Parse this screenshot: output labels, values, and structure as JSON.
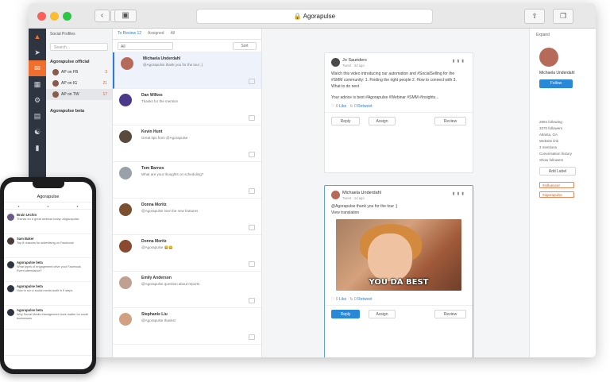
{
  "browser": {
    "url": "Agorapulse"
  },
  "sidebar": {
    "title": "Social Profiles",
    "search_placeholder": "Search...",
    "org1": "Agorapulse official",
    "accounts": [
      {
        "label": "AP on FB",
        "count": "3"
      },
      {
        "label": "AP on IG",
        "count": "21"
      },
      {
        "label": "AP on TW",
        "count": "17"
      }
    ],
    "org2": "Agorapulse beta"
  },
  "inbox": {
    "tabs": [
      "To Review 12",
      "Assigned",
      "All"
    ],
    "filter": "All",
    "sort": "Sort"
  },
  "colors": {
    "accent": "#2a88d8",
    "brand": "#ef6f2e",
    "rail": "#2f3540"
  },
  "main": {
    "card1": {
      "name": "Jo Saunders",
      "body": "Watch this video introducing our automation and #SocialSelling for the #SMM community: 1. Finding the right people 2. How to connect with 3. What to do next",
      "tags": "Your advice is best #Agorapulse #Webinar #SMM #Insights...",
      "reply": "Reply",
      "assign": "Assign",
      "review": "Review"
    },
    "card2": {
      "name": "Michaela Underdahl",
      "body": "@Agorapulse thank you for the tour ;)",
      "link": "View translation",
      "gif_caption": "YOU DA BEST",
      "reply": "Reply",
      "assign": "Assign",
      "review": "Review"
    }
  },
  "profile": {
    "expand": "Expand",
    "name": "Michaela Underdahl",
    "follow": "Follow",
    "stats": [
      "2894 following",
      "3370 followers",
      "Atlanta, GA",
      "Website link",
      "3 mentions",
      "Conversation history",
      "Show followers"
    ],
    "label_btn": "Add Label",
    "tags": [
      "#influencer",
      "#agorapulse"
    ]
  },
  "phone": {
    "app_title": "Agorapulse",
    "items": [
      {
        "name": "Brain Urchin",
        "text": "Thanks for a great webinar today. #Agorapulse"
      },
      {
        "name": "Sam Baker",
        "text": "Top 8 reasons for advertising on Facebook"
      },
      {
        "name": "Agorapulse beta",
        "text": "What types of engagement drive your Facebook Event attendance?"
      },
      {
        "name": "Agorapulse beta",
        "text": "How to run a social media audit in 5 steps."
      },
      {
        "name": "Agorapulse beta",
        "text": "Why Social Media Management tools matter for small businesses"
      }
    ]
  }
}
